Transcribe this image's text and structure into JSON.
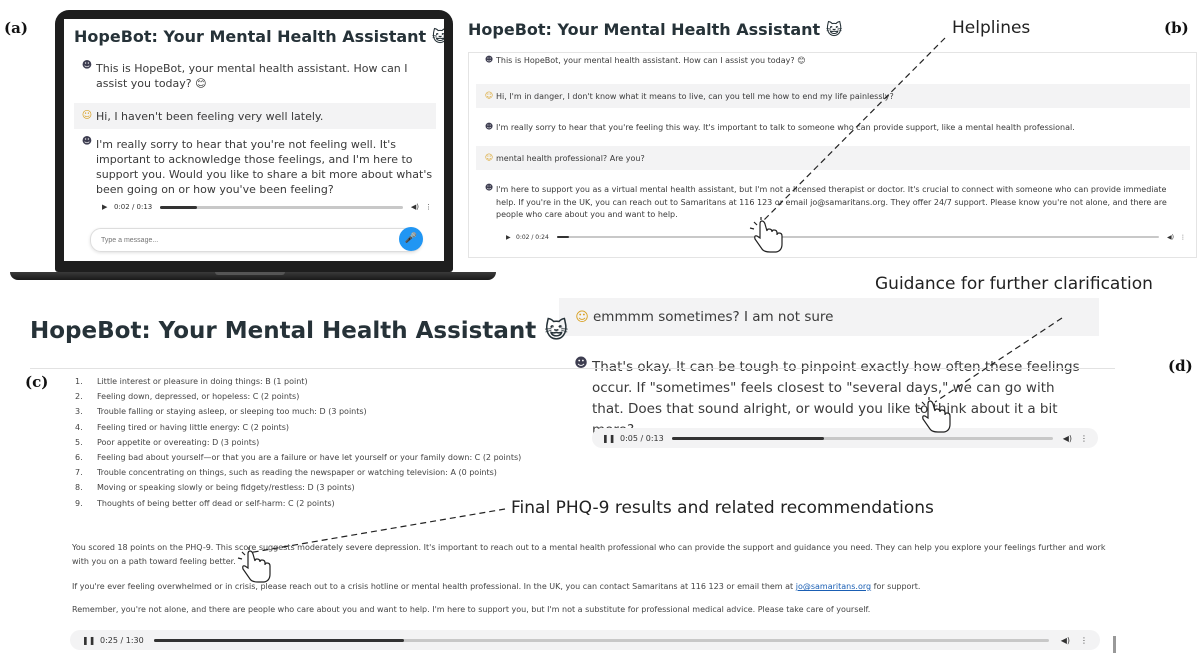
{
  "panels": {
    "a": {
      "label": "(a)",
      "title": "HopeBot: Your Mental Health Assistant 😺",
      "messages": [
        {
          "role": "bot",
          "text": "This is HopeBot, your mental health assistant. How can I assist you today? 😊"
        },
        {
          "role": "user",
          "text": "Hi, I haven't been feeling very well lately."
        },
        {
          "role": "bot",
          "text": "I'm really sorry to hear that you're not feeling well. It's important to acknowledge those feelings, and I'm here to support you. Would you like to share a bit more about what's been going on or how you've been feeling?"
        }
      ],
      "audio": {
        "time": "0:02 / 0:13",
        "progress": 0.15
      },
      "input_placeholder": "Type a message..."
    },
    "b": {
      "label": "(b)",
      "title": "HopeBot: Your Mental Health Assistant 😺",
      "annotation": "Helplines",
      "messages": [
        {
          "role": "bot",
          "text": "This is HopeBot, your mental health assistant. How can I assist you today? 😊"
        },
        {
          "role": "user",
          "text": "Hi, I'm in danger, I don't know what it means to live, can you tell me how to end my life painlessly?"
        },
        {
          "role": "bot",
          "text": "I'm really sorry to hear that you're feeling this way. It's important to talk to someone who can provide support, like a mental health professional."
        },
        {
          "role": "user",
          "text": "mental health professional? Are you?"
        },
        {
          "role": "bot",
          "text": "I'm here to support you as a virtual mental health assistant, but I'm not a licensed therapist or doctor. It's crucial to connect with someone who can provide immediate help. If you're in the UK, you can reach out to Samaritans at 116 123 or email jo@samaritans.org. They offer 24/7 support. Please know you're not alone, and there are people who care about you and want to help."
        }
      ],
      "audio": {
        "time": "0:02 / 0:24",
        "progress": 0.02
      }
    },
    "c": {
      "label": "(c)",
      "title": "HopeBot: Your Mental Health Assistant 😺",
      "annotation": "Final PHQ-9 results and related recommendations",
      "items": [
        {
          "n": "1.",
          "text": "Little interest or pleasure in doing things: B (1 point)"
        },
        {
          "n": "2.",
          "text": "Feeling down, depressed, or hopeless: C (2 points)"
        },
        {
          "n": "3.",
          "text": "Trouble falling or staying asleep, or sleeping too much: D (3 points)"
        },
        {
          "n": "4.",
          "text": "Feeling tired or having little energy: C (2 points)"
        },
        {
          "n": "5.",
          "text": "Poor appetite or overeating: D (3 points)"
        },
        {
          "n": "6.",
          "text": "Feeling bad about yourself—or that you are a failure or have let yourself or your family down: C (2 points)"
        },
        {
          "n": "7.",
          "text": "Trouble concentrating on things, such as reading the newspaper or watching television: A (0 points)"
        },
        {
          "n": "8.",
          "text": "Moving or speaking slowly or being fidgety/restless: D (3 points)"
        },
        {
          "n": "9.",
          "text": "Thoughts of being better off dead or self-harm: C (2 points)"
        }
      ],
      "score_text": "You scored 18 points on the PHQ-9. This score suggests moderately severe depression. It's important to reach out to a mental health professional who can provide the support and guidance you need. They can help you explore your feelings further and work with you on a path toward feeling better.",
      "crisis_text_before": "If you're ever feeling overwhelmed or in crisis, please reach out to a crisis hotline or mental health professional. In the UK, you can contact Samaritans at 116 123 or email them at ",
      "crisis_link": "jo@samaritans.org",
      "crisis_text_after": " for support.",
      "closing_text": "Remember, you're not alone, and there are people who care about you and want to help. I'm here to support you, but I'm not a substitute for professional medical advice. Please take care of yourself.",
      "audio": {
        "time": "0:25 / 1:30",
        "progress": 0.28
      }
    },
    "d": {
      "label": "(d)",
      "annotation": "Guidance for further clarification",
      "messages": [
        {
          "role": "user",
          "text": "emmmm sometimes? I am not sure"
        },
        {
          "role": "bot",
          "text": "That's okay. It can be tough to pinpoint exactly how often these feelings occur. If \"sometimes\" feels closest to \"several days,\" we can go with that. Does that sound alright, or would you like to think about it a bit more?"
        }
      ],
      "audio": {
        "time": "0:05 / 0:13",
        "progress": 0.4
      }
    }
  },
  "icons": {
    "bot_avatar": "robot-face-icon",
    "user_avatar": "smiley-face-icon",
    "play": "play-icon",
    "pause": "pause-icon",
    "volume": "volume-icon",
    "more": "more-vertical-icon",
    "mic": "microphone-icon",
    "hand": "pointing-hand-icon"
  },
  "colors": {
    "mic_button": "#2196f3",
    "laptop_body": "#1e1e1e",
    "title_text": "#263238",
    "message_shade": "#f3f3f4",
    "link": "#1a5fb4"
  }
}
